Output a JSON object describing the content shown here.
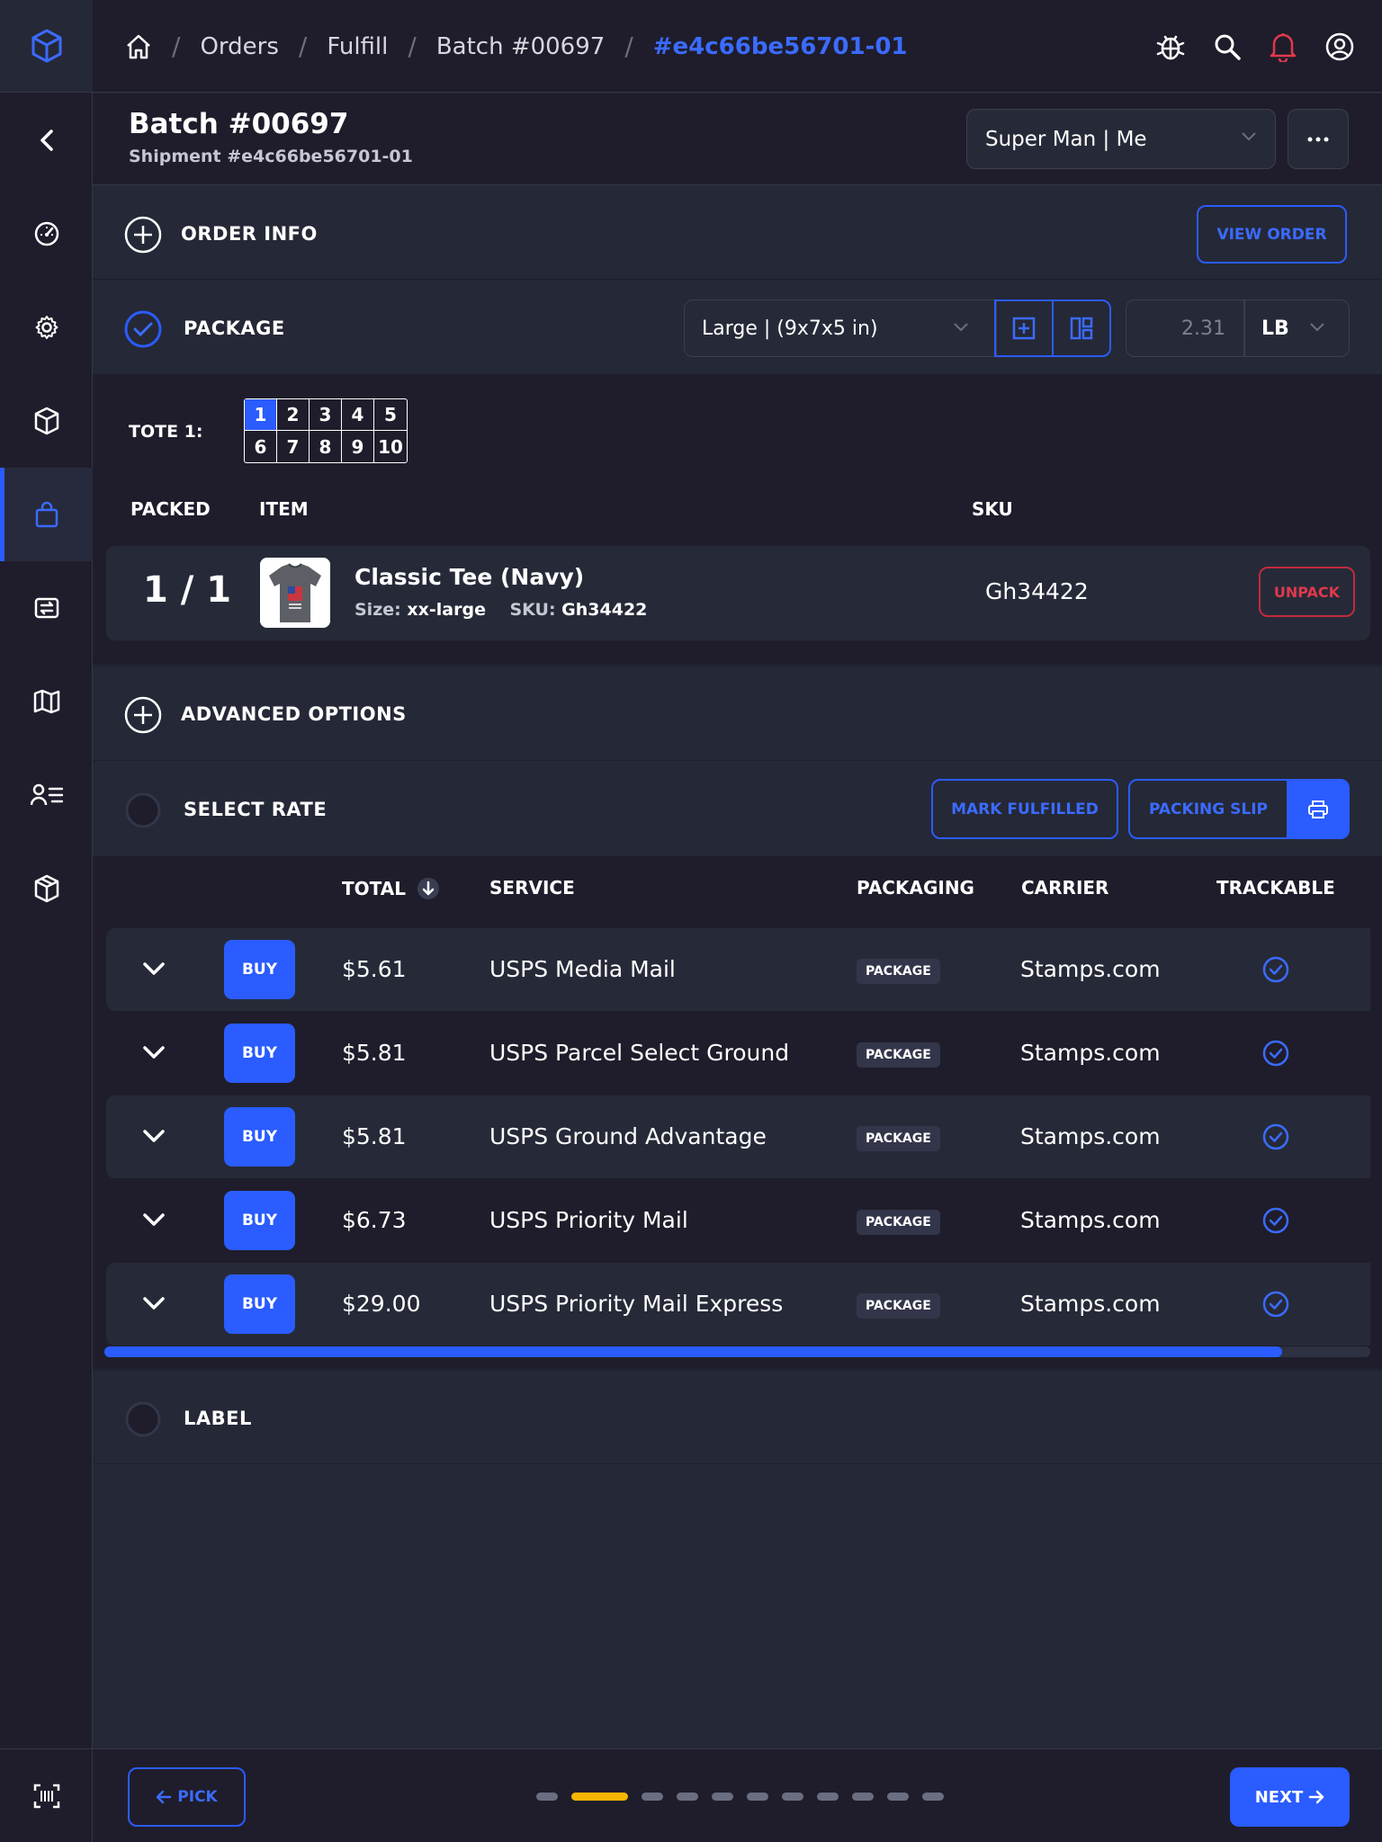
{
  "colors": {
    "accent": "#2a5cff",
    "bg": "#252836",
    "panel": "#1f1d2b",
    "danger": "#e0394c",
    "progress_active": "#f5b400"
  },
  "sidebar": {
    "items": [
      {
        "name": "collapse",
        "icon": "chevron-left-icon"
      },
      {
        "name": "dashboard",
        "icon": "speedometer-icon"
      },
      {
        "name": "settings",
        "icon": "gear-icon"
      },
      {
        "name": "inventory",
        "icon": "box-icon"
      },
      {
        "name": "fulfill",
        "icon": "shopping-bag-icon",
        "active": true
      },
      {
        "name": "transfers",
        "icon": "transfer-icon"
      },
      {
        "name": "map",
        "icon": "map-icon"
      },
      {
        "name": "customers",
        "icon": "user-list-icon"
      },
      {
        "name": "packages",
        "icon": "package-icon"
      }
    ],
    "bottom_icon": "barcode-scan-icon"
  },
  "topbar": {
    "breadcrumbs": [
      "Orders",
      "Fulfill",
      "Batch #00697"
    ],
    "current": "#e4c66be56701-01"
  },
  "header": {
    "title": "Batch #00697",
    "subtitle": "Shipment #e4c66be56701-01",
    "user_select": "Super Man | Me"
  },
  "order_info": {
    "title": "ORDER INFO",
    "view_order": "VIEW ORDER"
  },
  "package": {
    "title": "PACKAGE",
    "size_select": "Large | (9x7x5 in)",
    "weight": "2.31",
    "unit": "LB"
  },
  "tote": {
    "label": "TOTE 1:",
    "cells": [
      "1",
      "2",
      "3",
      "4",
      "5",
      "6",
      "7",
      "8",
      "9",
      "10"
    ],
    "active_index": 0
  },
  "items_table": {
    "headers": {
      "packed": "PACKED",
      "item": "ITEM",
      "sku": "SKU"
    },
    "rows": [
      {
        "packed": "1 / 1",
        "name": "Classic Tee (Navy)",
        "size_label": "Size:",
        "size": "xx-large",
        "sku_label": "SKU:",
        "sku_inline": "Gh34422",
        "sku": "Gh34422",
        "action": "UNPACK"
      }
    ]
  },
  "advanced": {
    "title": "ADVANCED OPTIONS"
  },
  "select_rate": {
    "title": "SELECT RATE",
    "mark_fulfilled": "MARK FULFILLED",
    "packing_slip": "PACKING SLIP"
  },
  "rates": {
    "headers": {
      "total": "TOTAL",
      "service": "SERVICE",
      "packaging": "PACKAGING",
      "carrier": "CARRIER",
      "trackable": "TRACKABLE"
    },
    "rows": [
      {
        "buy": "BUY",
        "total": "$5.61",
        "service": "USPS Media Mail",
        "packaging": "PACKAGE",
        "carrier": "Stamps.com",
        "trackable": true
      },
      {
        "buy": "BUY",
        "total": "$5.81",
        "service": "USPS Parcel Select Ground",
        "packaging": "PACKAGE",
        "carrier": "Stamps.com",
        "trackable": true
      },
      {
        "buy": "BUY",
        "total": "$5.81",
        "service": "USPS Ground Advantage",
        "packaging": "PACKAGE",
        "carrier": "Stamps.com",
        "trackable": true
      },
      {
        "buy": "BUY",
        "total": "$6.73",
        "service": "USPS Priority Mail",
        "packaging": "PACKAGE",
        "carrier": "Stamps.com",
        "trackable": true
      },
      {
        "buy": "BUY",
        "total": "$29.00",
        "service": "USPS Priority Mail Express",
        "packaging": "PACKAGE",
        "carrier": "Stamps.com",
        "trackable": true
      }
    ],
    "scroll_fraction": 0.93
  },
  "label_section": {
    "title": "LABEL"
  },
  "footer": {
    "pick": "PICK",
    "next": "NEXT",
    "steps_total": 11,
    "step_active": 2
  }
}
